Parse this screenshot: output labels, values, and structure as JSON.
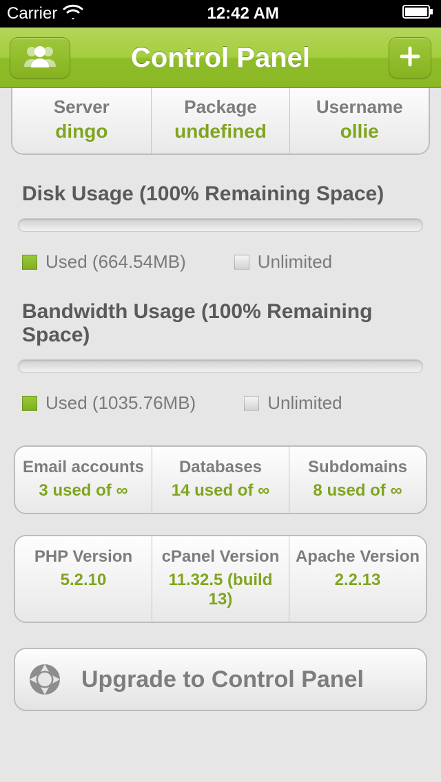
{
  "status": {
    "carrier": "Carrier",
    "time": "12:42 AM"
  },
  "nav": {
    "title": "Control Panel"
  },
  "info_cells": [
    {
      "label": "Server",
      "value": "dingo"
    },
    {
      "label": "Package",
      "value": "undefined"
    },
    {
      "label": "Username",
      "value": "ollie"
    }
  ],
  "disk": {
    "title": "Disk Usage (100% Remaining Space)",
    "used_label": "Used (664.54MB)",
    "limit_label": "Unlimited"
  },
  "bandwidth": {
    "title": "Bandwidth Usage (100% Remaining Space)",
    "used_label": "Used (1035.76MB)",
    "limit_label": "Unlimited"
  },
  "quota_cells": [
    {
      "label": "Email accounts",
      "value": "3 used of ∞"
    },
    {
      "label": "Databases",
      "value": "14 used of ∞"
    },
    {
      "label": "Subdomains",
      "value": "8 used of ∞"
    }
  ],
  "version_cells": [
    {
      "label": "PHP Version",
      "value": "5.2.10"
    },
    {
      "label": "cPanel Version",
      "value": "11.32.5 (build 13)"
    },
    {
      "label": "Apache Version",
      "value": "2.2.13"
    }
  ],
  "upgrade": {
    "label": "Upgrade to Control Panel"
  }
}
